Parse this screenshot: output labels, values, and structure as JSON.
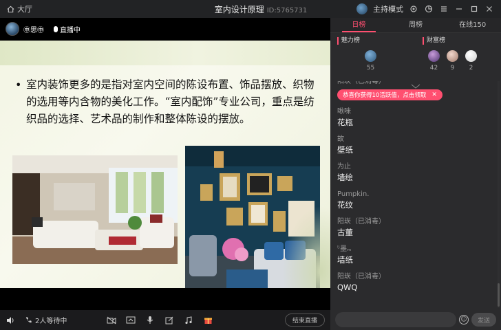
{
  "titlebar": {
    "home_label": "大厅",
    "title": "室内设计原理",
    "room_id": "ID:5765731",
    "mode_label": "主持模式"
  },
  "host": {
    "name": "㊥思㊥",
    "live_label": "直播中"
  },
  "slide": {
    "text": "室内装饰更多的是指对室内空间的陈设布置、饰品摆放、织物的选用等内含物的美化工作。“室内配饰”专业公司，重点是纺织品的选择、艺术品的制作和整体陈设的摆放。"
  },
  "bottombar": {
    "waiting_label": "2人等待中",
    "end_live_label": "结束直播"
  },
  "panel": {
    "tabs": [
      {
        "label": "日榜",
        "active": true
      },
      {
        "label": "周榜",
        "active": false
      },
      {
        "label": "在线150",
        "active": false
      }
    ],
    "charm": {
      "title": "魅力榜",
      "items": [
        {
          "value": "55",
          "color": "#3f6f98"
        }
      ]
    },
    "wealth": {
      "title": "财富榜",
      "items": [
        {
          "value": "42",
          "color": "#7a5d9c"
        },
        {
          "value": "9",
          "color": "#c9a89a"
        },
        {
          "value": "2",
          "color": "#e6e6e6"
        }
      ]
    },
    "top_partial_user": "阳崁（已消毒）",
    "reward_notice": "恭喜你获得10活跃值，点击领取",
    "chat": [
      {
        "user": "啾咪",
        "msg": "花瓶"
      },
      {
        "user": "故",
        "msg": "壁纸"
      },
      {
        "user": "为止",
        "msg": "墙绘"
      },
      {
        "user": "Pumpkin.",
        "msg": "花纹"
      },
      {
        "user": "阳崁（已消毒）",
        "msg": "古董"
      },
      {
        "user": "ᵕ̈墨ₘ",
        "msg": "墙纸"
      },
      {
        "user": "阳崁（已消毒）",
        "msg": "QWQ"
      }
    ],
    "send_label": "发送"
  },
  "colors": {
    "accent": "#ff4f70",
    "panel_bg": "#2b2b2d",
    "video_bg": "#000000"
  }
}
